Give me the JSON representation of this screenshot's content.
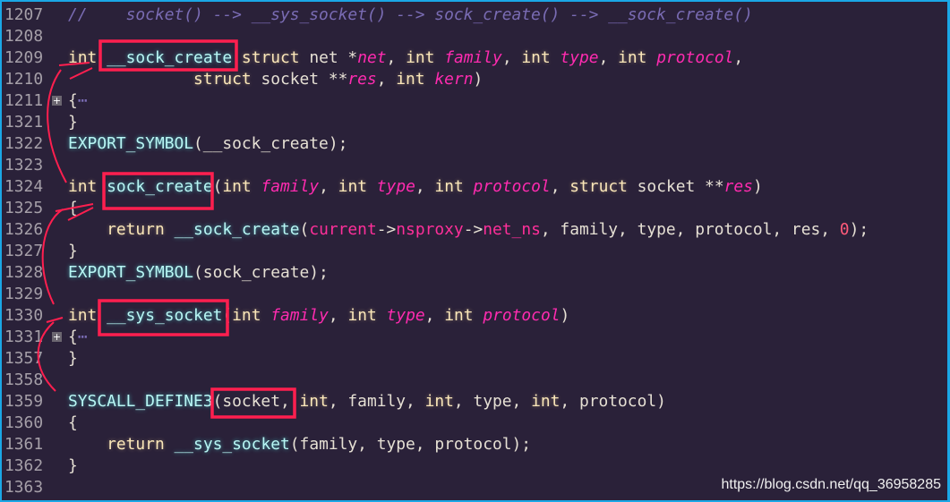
{
  "lines": [
    {
      "n": "1207",
      "t": [
        [
          "cm",
          "//    socket() --> __sys_socket() --> sock_create() --> __sock_create()"
        ]
      ]
    },
    {
      "n": "1208",
      "t": []
    },
    {
      "n": "1209",
      "t": [
        [
          "kw",
          "int"
        ],
        [
          "tx",
          " "
        ],
        [
          "fn",
          "__sock_create"
        ],
        [
          "tx",
          " "
        ],
        [
          "kw",
          "struct"
        ],
        [
          "tx",
          " net *"
        ],
        [
          "pa",
          "net"
        ],
        [
          "tx",
          ", "
        ],
        [
          "kw",
          "int"
        ],
        [
          "tx",
          " "
        ],
        [
          "pa",
          "family"
        ],
        [
          "tx",
          ", "
        ],
        [
          "kw",
          "int"
        ],
        [
          "tx",
          " "
        ],
        [
          "pa",
          "type"
        ],
        [
          "tx",
          ", "
        ],
        [
          "kw",
          "int"
        ],
        [
          "tx",
          " "
        ],
        [
          "pa",
          "protocol"
        ],
        [
          "tx",
          ","
        ]
      ]
    },
    {
      "n": "1210",
      "t": [
        [
          "tx",
          "             "
        ],
        [
          "kw",
          "struct"
        ],
        [
          "tx",
          " socket **"
        ],
        [
          "pa",
          "res"
        ],
        [
          "tx",
          ", "
        ],
        [
          "kw",
          "int"
        ],
        [
          "tx",
          " "
        ],
        [
          "pa",
          "kern"
        ],
        [
          "tx",
          ")"
        ]
      ]
    },
    {
      "n": "1211",
      "fold": true,
      "t": [
        [
          "tx",
          "{"
        ],
        [
          "cm",
          "⋯"
        ]
      ]
    },
    {
      "n": "1321",
      "t": [
        [
          "tx",
          "}"
        ]
      ]
    },
    {
      "n": "1322",
      "t": [
        [
          "fn",
          "EXPORT_SYMBOL"
        ],
        [
          "tx",
          "(__sock_create);"
        ]
      ]
    },
    {
      "n": "1323",
      "t": []
    },
    {
      "n": "1324",
      "t": [
        [
          "kw",
          "int"
        ],
        [
          "tx",
          " "
        ],
        [
          "fn",
          "sock_create"
        ],
        [
          "tx",
          "("
        ],
        [
          "kw",
          "int"
        ],
        [
          "tx",
          " "
        ],
        [
          "pa",
          "family"
        ],
        [
          "tx",
          ", "
        ],
        [
          "kw",
          "int"
        ],
        [
          "tx",
          " "
        ],
        [
          "pa",
          "type"
        ],
        [
          "tx",
          ", "
        ],
        [
          "kw",
          "int"
        ],
        [
          "tx",
          " "
        ],
        [
          "pa",
          "protocol"
        ],
        [
          "tx",
          ", "
        ],
        [
          "kw",
          "struct"
        ],
        [
          "tx",
          " socket **"
        ],
        [
          "pa",
          "res"
        ],
        [
          "tx",
          ")"
        ]
      ]
    },
    {
      "n": "1325",
      "t": [
        [
          "tx",
          "{"
        ]
      ]
    },
    {
      "n": "1326",
      "t": [
        [
          "tx",
          "    "
        ],
        [
          "kw",
          "return"
        ],
        [
          "tx",
          " "
        ],
        [
          "fn",
          "__sock_create"
        ],
        [
          "tx",
          "("
        ],
        [
          "mb",
          "current"
        ],
        [
          "tx",
          "->"
        ],
        [
          "mb",
          "nsproxy"
        ],
        [
          "tx",
          "->"
        ],
        [
          "mb",
          "net_ns"
        ],
        [
          "tx",
          ", family, type, protocol, res, "
        ],
        [
          "nu",
          "0"
        ],
        [
          "tx",
          ");"
        ]
      ]
    },
    {
      "n": "1327",
      "t": [
        [
          "tx",
          "}"
        ]
      ]
    },
    {
      "n": "1328",
      "t": [
        [
          "fn",
          "EXPORT_SYMBOL"
        ],
        [
          "tx",
          "(sock_create);"
        ]
      ]
    },
    {
      "n": "1329",
      "t": []
    },
    {
      "n": "1330",
      "t": [
        [
          "kw",
          "int"
        ],
        [
          "tx",
          " "
        ],
        [
          "fn",
          "__sys_socket"
        ],
        [
          "tx",
          "("
        ],
        [
          "kw",
          "int"
        ],
        [
          "tx",
          " "
        ],
        [
          "pa",
          "family"
        ],
        [
          "tx",
          ", "
        ],
        [
          "kw",
          "int"
        ],
        [
          "tx",
          " "
        ],
        [
          "pa",
          "type"
        ],
        [
          "tx",
          ", "
        ],
        [
          "kw",
          "int"
        ],
        [
          "tx",
          " "
        ],
        [
          "pa",
          "protocol"
        ],
        [
          "tx",
          ")"
        ]
      ]
    },
    {
      "n": "1331",
      "fold": true,
      "t": [
        [
          "tx",
          "{"
        ],
        [
          "cm",
          "⋯"
        ]
      ]
    },
    {
      "n": "1357",
      "t": [
        [
          "tx",
          "}"
        ]
      ]
    },
    {
      "n": "1358",
      "t": []
    },
    {
      "n": "1359",
      "t": [
        [
          "fn",
          "SYSCALL_DEFINE3"
        ],
        [
          "tx",
          "(socket, "
        ],
        [
          "kw",
          "int"
        ],
        [
          "tx",
          ", family, "
        ],
        [
          "kw",
          "int"
        ],
        [
          "tx",
          ", type, "
        ],
        [
          "kw",
          "int"
        ],
        [
          "tx",
          ", protocol)"
        ]
      ]
    },
    {
      "n": "1360",
      "t": [
        [
          "tx",
          "{"
        ]
      ]
    },
    {
      "n": "1361",
      "t": [
        [
          "tx",
          "    "
        ],
        [
          "kw",
          "return"
        ],
        [
          "tx",
          " "
        ],
        [
          "fn",
          "__sys_socket"
        ],
        [
          "tx",
          "(family, type, protocol);"
        ]
      ]
    },
    {
      "n": "1362",
      "t": [
        [
          "tx",
          "}"
        ]
      ]
    },
    {
      "n": "1363",
      "t": []
    }
  ],
  "watermark": "https://blog.csdn.net/qq_36958285",
  "colors": {
    "background": "#2a2139",
    "annotation": "#ff1f4f",
    "border": "#1aa7e6"
  }
}
